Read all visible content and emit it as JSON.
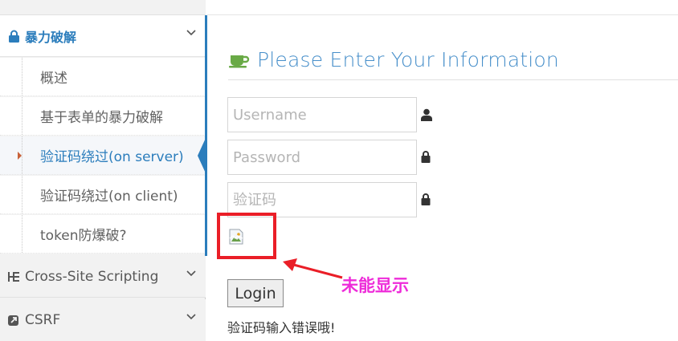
{
  "sidebar": {
    "active_group": {
      "label": "暴力破解",
      "icon": "lock-icon"
    },
    "items": [
      {
        "label": "概述"
      },
      {
        "label": "基于表单的暴力破解"
      },
      {
        "label": "验证码绕过(on server)",
        "active": true
      },
      {
        "label": "验证码绕过(on client)"
      },
      {
        "label": "token防爆破?"
      }
    ],
    "groups": [
      {
        "label": "Cross-Site Scripting",
        "icon": "sitemap-icon"
      },
      {
        "label": "CSRF",
        "icon": "share-icon"
      }
    ]
  },
  "main": {
    "title": "Please Enter Your Information",
    "title_icon": "coffee-cup-icon",
    "form": {
      "username_placeholder": "Username",
      "password_placeholder": "Password",
      "vcode_placeholder": "验证码",
      "login_label": "Login"
    },
    "captcha_image": {
      "state": "broken"
    },
    "annotation": {
      "label": "未能显示",
      "color": "#ee2bd9",
      "box_color": "#ea1e27"
    },
    "error_message": "验证码输入错误哦!"
  },
  "colors": {
    "accent": "#2b7dbc",
    "title": "#478fca",
    "cup": "#69aa46"
  }
}
